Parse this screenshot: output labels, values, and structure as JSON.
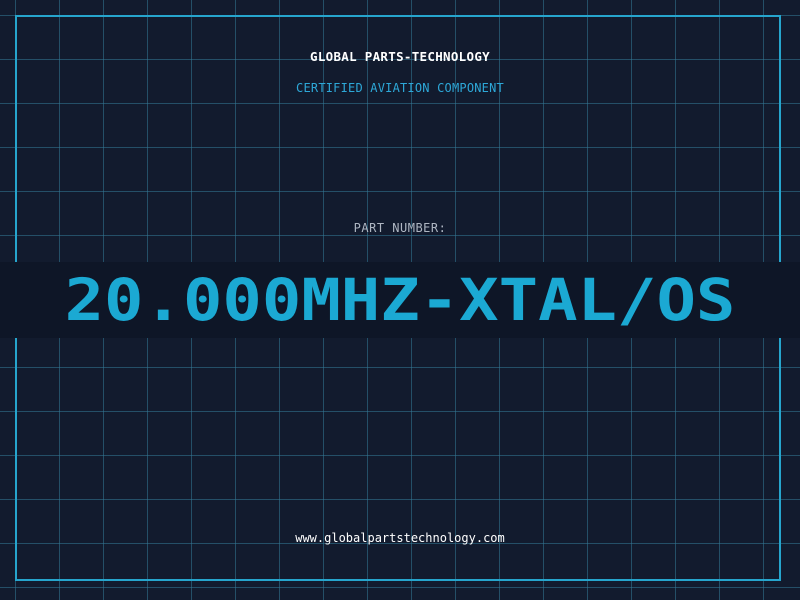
{
  "header": {
    "company": "GLOBAL PARTS-TECHNOLOGY",
    "subtitle": "CERTIFIED AVIATION COMPONENT"
  },
  "part": {
    "label": "PART NUMBER:",
    "number": "20.000MHZ-XTAL/OS"
  },
  "footer": {
    "url": "www.globalpartstechnology.com"
  },
  "colors": {
    "background": "#121b2e",
    "grid": "#347a96",
    "frame": "#26a5cd",
    "accent": "#1ba9d3",
    "label": "#aeb6c2",
    "text": "#ffffff"
  }
}
